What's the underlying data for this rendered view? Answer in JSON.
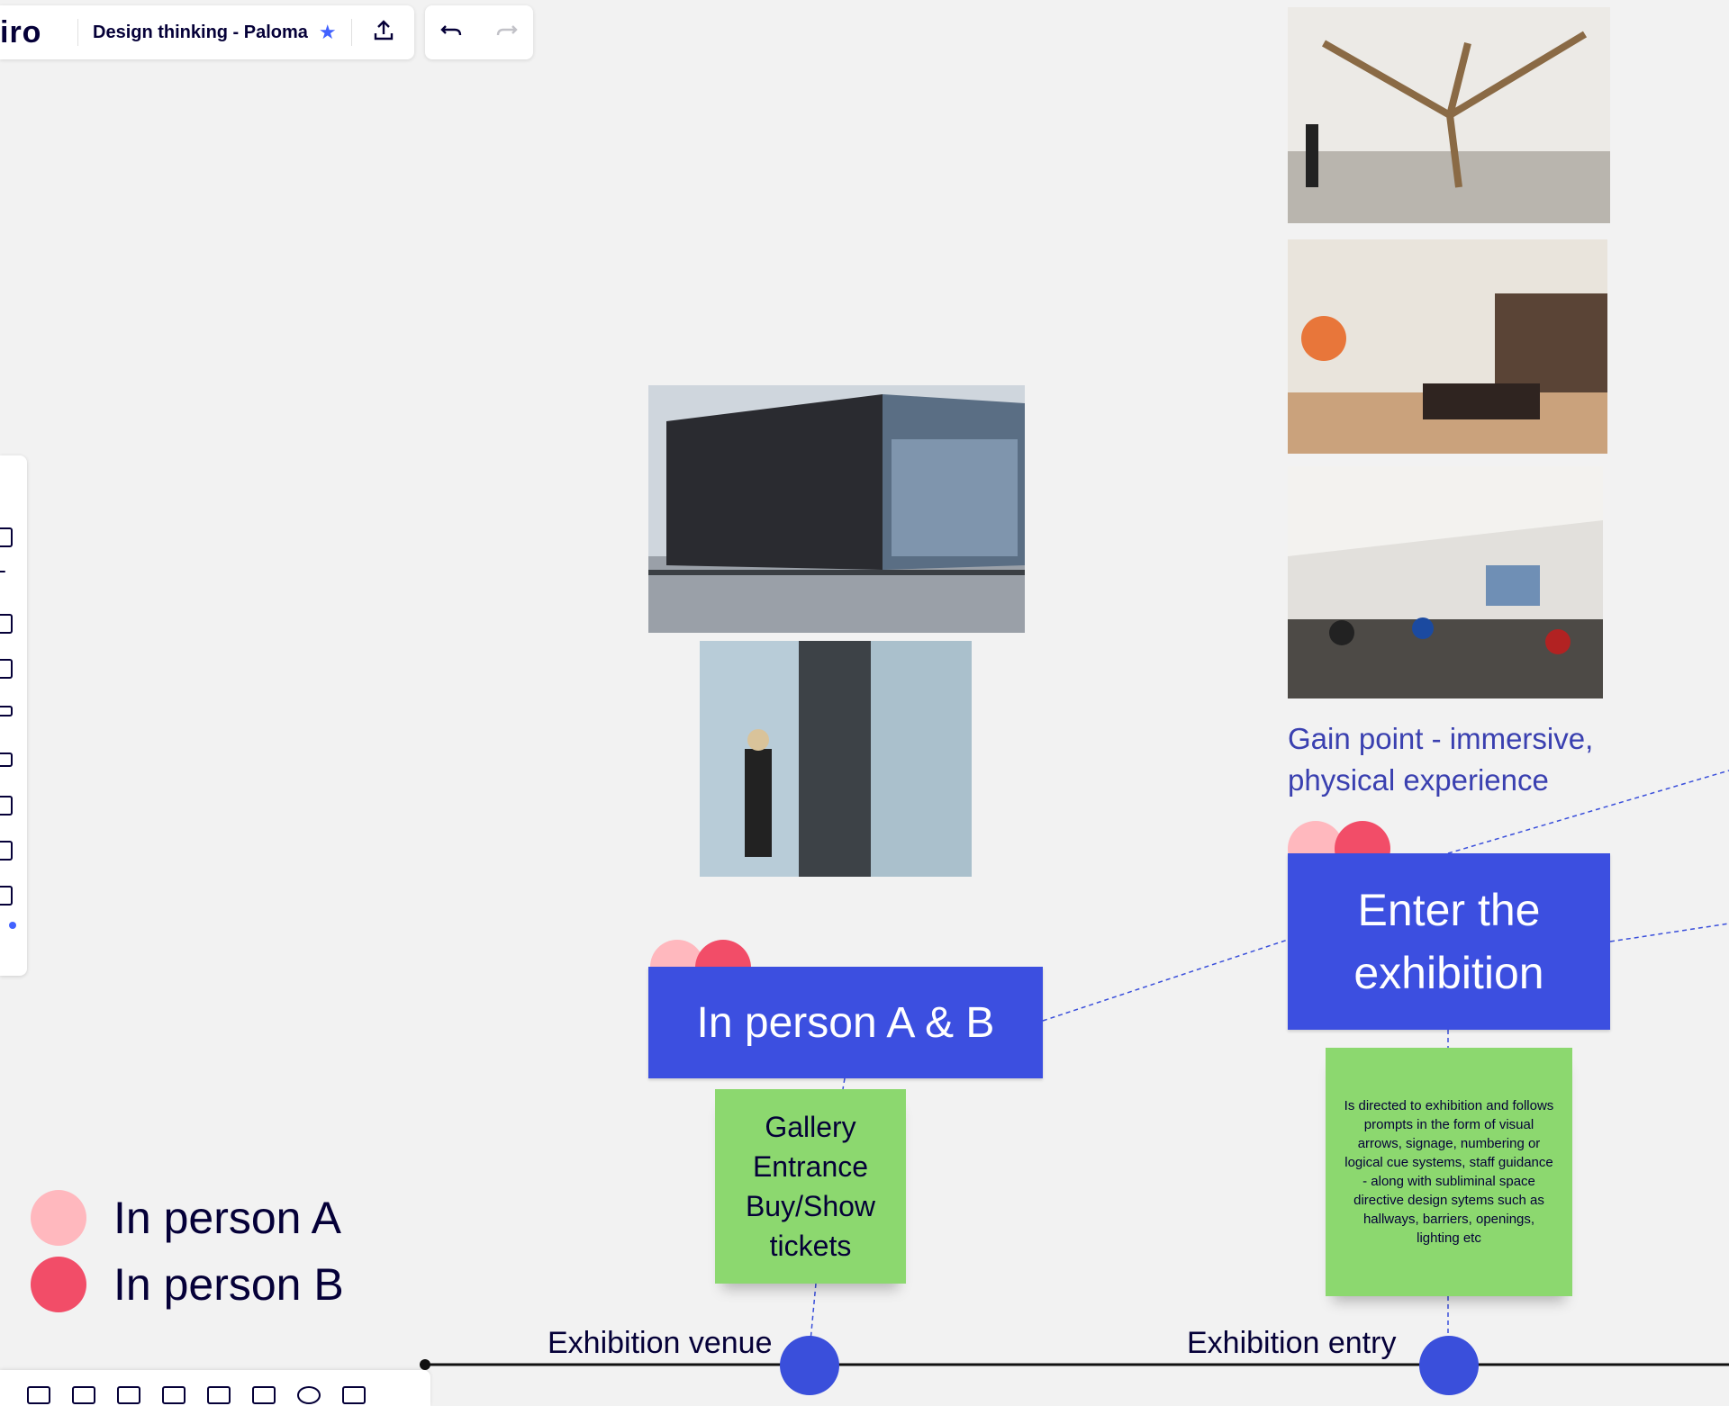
{
  "app": {
    "logo_text": "iro",
    "board_title": "Design thinking - Paloma"
  },
  "icons": {
    "star": "star-icon",
    "share": "upload-icon",
    "undo": "undo-icon",
    "redo": "redo-icon"
  },
  "colors": {
    "accent": "#4262ff",
    "card_blue": "#3c4fe0",
    "sticky_green": "#8cd86f",
    "person_a": "#ffb8be",
    "person_b": "#f24d68",
    "text_blue": "#3a40b0"
  },
  "board": {
    "card_in_person": "In person A & B",
    "card_enter": "Enter the exhibition",
    "sticky_gallery": [
      "Gallery",
      "Entrance",
      "Buy/Show",
      "tickets"
    ],
    "sticky_directed": "Is directed to exhibition and follows prompts in the form of visual arrows, signage, numbering or logical cue systems, staff guidance  - along with subliminal space directive design sytems such as hallways, barriers, openings, lighting etc",
    "gain_point": "Gain point - immersive, physical experience",
    "stage_venue": "Exhibition venue",
    "stage_entry": "Exhibition entry",
    "legend": [
      {
        "label": "In person A"
      },
      {
        "label": "In person B"
      }
    ]
  }
}
